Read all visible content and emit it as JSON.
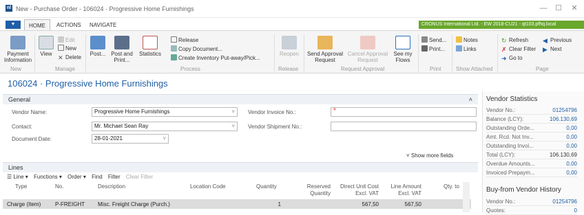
{
  "window": {
    "title": "New - Purchase Order - 106024 · Progressive Home Furnishings",
    "logo": "nl",
    "minimize": "—",
    "maximize": "☐",
    "close": "✕"
  },
  "tabs": {
    "menu": "▼",
    "items": [
      "HOME",
      "ACTIONS",
      "NAVIGATE"
    ],
    "company": "CRONUS International Ltd. - EW 2018-CU21 - qt103.pfhq.local"
  },
  "ribbon": {
    "new_group": {
      "payment_information": "Payment Information",
      "label": "New"
    },
    "manage_group": {
      "view": "View",
      "edit": "Edit",
      "new": "New",
      "delete": "Delete",
      "label": "Manage"
    },
    "process_group": {
      "post": "Post...",
      "post_and_print": "Post and Print...",
      "statistics": "Statistics",
      "release": "Release",
      "copy_document": "Copy Document...",
      "create_inventory": "Create Inventory Put-away/Pick...",
      "label": "Process"
    },
    "release_group": {
      "reopen": "Reopen",
      "label": "Release"
    },
    "approval_group": {
      "send_approval": "Send Approval Request",
      "cancel_approval": "Cancel Approval Request",
      "see_flows": "See my Flows",
      "label": "Request Approval"
    },
    "print_group": {
      "send": "Send...",
      "print": "Print...",
      "label": "Print"
    },
    "attached_group": {
      "notes": "Notes",
      "links": "Links",
      "label": "Show Attached"
    },
    "page_group": {
      "refresh": "Refresh",
      "previous": "Previous",
      "clear_filter": "Clear Filter",
      "next": "Next",
      "goto": "Go to",
      "label": "Page"
    }
  },
  "page_title": "106024 · Progressive Home Furnishings",
  "general": {
    "header": "General",
    "collapse": "˄",
    "vendor_name_label": "Vendor Name:",
    "vendor_name": "Progressive Home Furnishings",
    "contact_label": "Contact:",
    "contact": "Mr. Michael Sean Ray",
    "document_date_label": "Document Date:",
    "document_date": "28-01-2021",
    "vendor_invoice_label": "Vendor Invoice No.:",
    "vendor_invoice": "",
    "vendor_shipment_label": "Vendor Shipment No.:",
    "vendor_shipment": "",
    "required_marker": "*",
    "show_more": "˅ Show more fields"
  },
  "lines": {
    "header": "Lines",
    "toolbar": [
      "☰ Line ▾",
      "Functions ▾",
      "Order ▾",
      "Find",
      "Filter",
      "Clear Filter"
    ],
    "columns": [
      "Type",
      "No.",
      "Description",
      "Location Code",
      "Quantity",
      "Reserved Quantity",
      "Direct Unit Cost Excl. VAT",
      "Line Amount Excl. VAT",
      "Qty. to"
    ],
    "rows": [
      {
        "type": "Charge (Item)",
        "no": "P-FREIGHT",
        "description": "Misc. Freight Charge (Purch.)",
        "location": "",
        "quantity": "1",
        "reserved": "",
        "unit_cost": "567,50",
        "line_amount": "567,50",
        "qty_to": ""
      }
    ]
  },
  "factbox": {
    "vendor_statistics": "Vendor Statistics",
    "rows": [
      {
        "k": "Vendor No.:",
        "v": "01254796"
      },
      {
        "k": "Balance (LCY):",
        "v": "106.130,69"
      },
      {
        "k": "Outstanding Orde...",
        "v": "0,00"
      },
      {
        "k": "Amt. Rcd. Not Inv...",
        "v": "0,00"
      },
      {
        "k": "Outstanding Invoi...",
        "v": "0,00"
      },
      {
        "k": "Total (LCY):",
        "v": "106.130,69"
      },
      {
        "k": "Overdue Amounts...",
        "v": "0,00"
      },
      {
        "k": "Invoiced Prepaym...",
        "v": "0,00"
      }
    ],
    "history_title": "Buy-from Vendor History",
    "history_rows": [
      {
        "k": "Vendor No.:",
        "v": "01254796"
      },
      {
        "k": "Quotes:",
        "v": "0"
      }
    ]
  },
  "colors": {
    "accent": "#1f5fa6",
    "company_bar": "#6aa72d"
  }
}
